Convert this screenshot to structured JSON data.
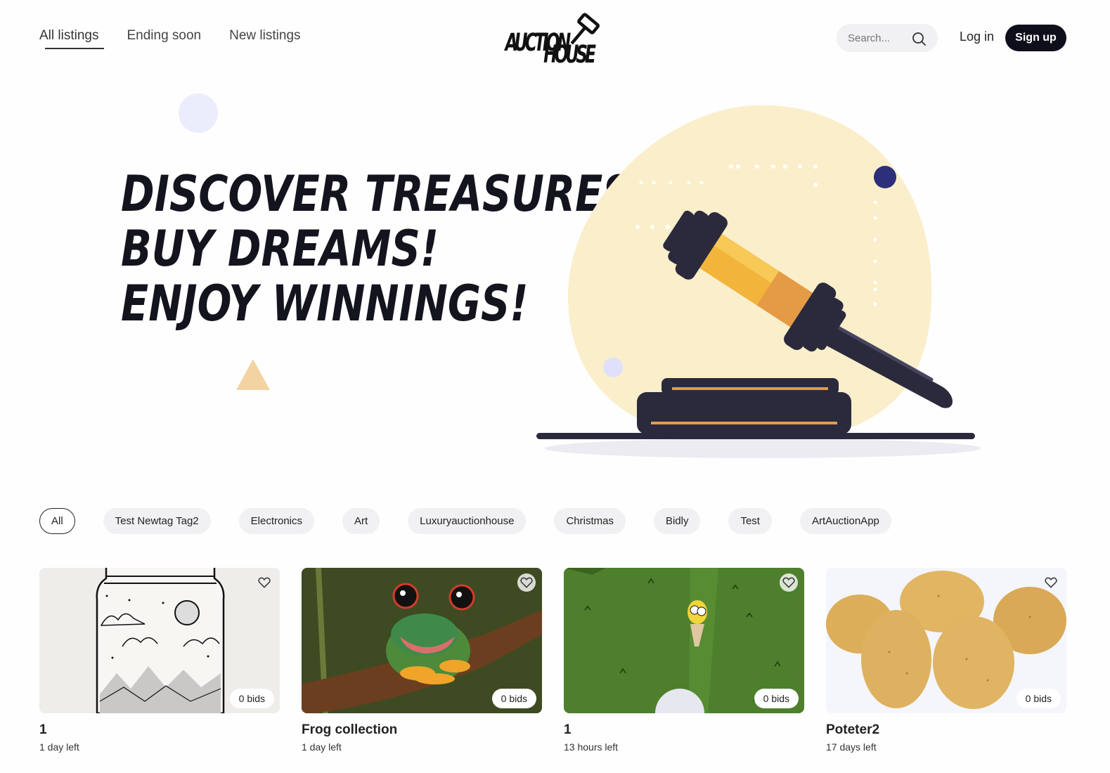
{
  "nav": {
    "links": [
      {
        "label": "All listings"
      },
      {
        "label": "Ending soon"
      },
      {
        "label": "New listings"
      }
    ],
    "logo_text": [
      "AUCTION",
      "HOUSE"
    ],
    "search_placeholder": "Search...",
    "login_label": "Log in",
    "signup_label": "Sign up"
  },
  "hero": {
    "lines": [
      "Discover treasures,",
      "Buy dreams!",
      "Enjoy winnings!"
    ],
    "colors": {
      "blob": "#fbeecb",
      "gavel_dark": "#2b2a3d",
      "gavel_gold": "#f2b43a",
      "accent_dot": "#2e2f7a"
    }
  },
  "filters": {
    "chips": [
      "All",
      "Test Newtag Tag2",
      "Electronics",
      "Art",
      "Luxuryauctionhouse",
      "Christmas",
      "Bidly",
      "Test",
      "ArtAuctionApp"
    ],
    "active": "All"
  },
  "listings": [
    {
      "title": "1",
      "time_left": "1 day left",
      "bids": "0 bids",
      "image": "jar-drawing"
    },
    {
      "title": "Frog collection",
      "time_left": "1 day left",
      "bids": "0 bids",
      "image": "frog-photo"
    },
    {
      "title": "1",
      "time_left": "13 hours left",
      "bids": "0 bids",
      "image": "grass-cartoon"
    },
    {
      "title": "Poteter2",
      "time_left": "17 days left",
      "bids": "0 bids",
      "image": "potatoes-photo"
    }
  ]
}
